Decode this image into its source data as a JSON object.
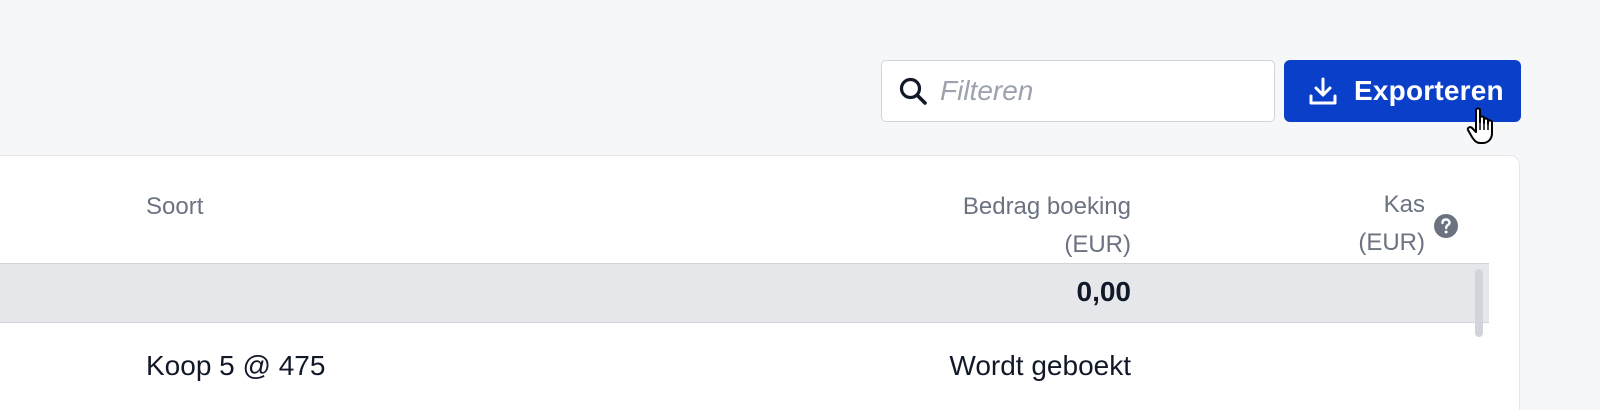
{
  "toolbar": {
    "filter_placeholder": "Filteren",
    "filter_value": "",
    "export_label": "Exporteren"
  },
  "icons": {
    "search": "search-icon",
    "export": "download-icon",
    "help": "question-circle-icon",
    "cursor": "hand-pointer-icon"
  },
  "colors": {
    "primary": "#0a3fc9",
    "page_bg": "#f6f7f9",
    "summary_bg": "#e5e7eb",
    "muted_text": "#6b7280"
  },
  "table": {
    "columns": {
      "soort": "Soort",
      "bedrag_line1": "Bedrag boeking",
      "bedrag_line2": "(EUR)",
      "kas_line1": "Kas",
      "kas_line2": "(EUR)"
    },
    "summary": {
      "bedrag": "0,00"
    },
    "rows": [
      {
        "soort": "Koop 5 @ 475",
        "bedrag": "Wordt geboekt"
      }
    ]
  }
}
